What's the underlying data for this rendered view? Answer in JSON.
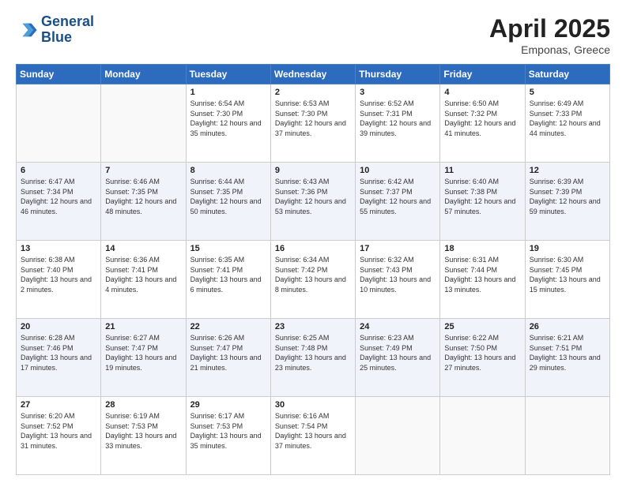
{
  "header": {
    "logo_line1": "General",
    "logo_line2": "Blue",
    "title": "April 2025",
    "location": "Emponas, Greece"
  },
  "days_of_week": [
    "Sunday",
    "Monday",
    "Tuesday",
    "Wednesday",
    "Thursday",
    "Friday",
    "Saturday"
  ],
  "weeks": [
    [
      {
        "day": "",
        "sunrise": "",
        "sunset": "",
        "daylight": ""
      },
      {
        "day": "",
        "sunrise": "",
        "sunset": "",
        "daylight": ""
      },
      {
        "day": "1",
        "sunrise": "Sunrise: 6:54 AM",
        "sunset": "Sunset: 7:30 PM",
        "daylight": "Daylight: 12 hours and 35 minutes."
      },
      {
        "day": "2",
        "sunrise": "Sunrise: 6:53 AM",
        "sunset": "Sunset: 7:30 PM",
        "daylight": "Daylight: 12 hours and 37 minutes."
      },
      {
        "day": "3",
        "sunrise": "Sunrise: 6:52 AM",
        "sunset": "Sunset: 7:31 PM",
        "daylight": "Daylight: 12 hours and 39 minutes."
      },
      {
        "day": "4",
        "sunrise": "Sunrise: 6:50 AM",
        "sunset": "Sunset: 7:32 PM",
        "daylight": "Daylight: 12 hours and 41 minutes."
      },
      {
        "day": "5",
        "sunrise": "Sunrise: 6:49 AM",
        "sunset": "Sunset: 7:33 PM",
        "daylight": "Daylight: 12 hours and 44 minutes."
      }
    ],
    [
      {
        "day": "6",
        "sunrise": "Sunrise: 6:47 AM",
        "sunset": "Sunset: 7:34 PM",
        "daylight": "Daylight: 12 hours and 46 minutes."
      },
      {
        "day": "7",
        "sunrise": "Sunrise: 6:46 AM",
        "sunset": "Sunset: 7:35 PM",
        "daylight": "Daylight: 12 hours and 48 minutes."
      },
      {
        "day": "8",
        "sunrise": "Sunrise: 6:44 AM",
        "sunset": "Sunset: 7:35 PM",
        "daylight": "Daylight: 12 hours and 50 minutes."
      },
      {
        "day": "9",
        "sunrise": "Sunrise: 6:43 AM",
        "sunset": "Sunset: 7:36 PM",
        "daylight": "Daylight: 12 hours and 53 minutes."
      },
      {
        "day": "10",
        "sunrise": "Sunrise: 6:42 AM",
        "sunset": "Sunset: 7:37 PM",
        "daylight": "Daylight: 12 hours and 55 minutes."
      },
      {
        "day": "11",
        "sunrise": "Sunrise: 6:40 AM",
        "sunset": "Sunset: 7:38 PM",
        "daylight": "Daylight: 12 hours and 57 minutes."
      },
      {
        "day": "12",
        "sunrise": "Sunrise: 6:39 AM",
        "sunset": "Sunset: 7:39 PM",
        "daylight": "Daylight: 12 hours and 59 minutes."
      }
    ],
    [
      {
        "day": "13",
        "sunrise": "Sunrise: 6:38 AM",
        "sunset": "Sunset: 7:40 PM",
        "daylight": "Daylight: 13 hours and 2 minutes."
      },
      {
        "day": "14",
        "sunrise": "Sunrise: 6:36 AM",
        "sunset": "Sunset: 7:41 PM",
        "daylight": "Daylight: 13 hours and 4 minutes."
      },
      {
        "day": "15",
        "sunrise": "Sunrise: 6:35 AM",
        "sunset": "Sunset: 7:41 PM",
        "daylight": "Daylight: 13 hours and 6 minutes."
      },
      {
        "day": "16",
        "sunrise": "Sunrise: 6:34 AM",
        "sunset": "Sunset: 7:42 PM",
        "daylight": "Daylight: 13 hours and 8 minutes."
      },
      {
        "day": "17",
        "sunrise": "Sunrise: 6:32 AM",
        "sunset": "Sunset: 7:43 PM",
        "daylight": "Daylight: 13 hours and 10 minutes."
      },
      {
        "day": "18",
        "sunrise": "Sunrise: 6:31 AM",
        "sunset": "Sunset: 7:44 PM",
        "daylight": "Daylight: 13 hours and 13 minutes."
      },
      {
        "day": "19",
        "sunrise": "Sunrise: 6:30 AM",
        "sunset": "Sunset: 7:45 PM",
        "daylight": "Daylight: 13 hours and 15 minutes."
      }
    ],
    [
      {
        "day": "20",
        "sunrise": "Sunrise: 6:28 AM",
        "sunset": "Sunset: 7:46 PM",
        "daylight": "Daylight: 13 hours and 17 minutes."
      },
      {
        "day": "21",
        "sunrise": "Sunrise: 6:27 AM",
        "sunset": "Sunset: 7:47 PM",
        "daylight": "Daylight: 13 hours and 19 minutes."
      },
      {
        "day": "22",
        "sunrise": "Sunrise: 6:26 AM",
        "sunset": "Sunset: 7:47 PM",
        "daylight": "Daylight: 13 hours and 21 minutes."
      },
      {
        "day": "23",
        "sunrise": "Sunrise: 6:25 AM",
        "sunset": "Sunset: 7:48 PM",
        "daylight": "Daylight: 13 hours and 23 minutes."
      },
      {
        "day": "24",
        "sunrise": "Sunrise: 6:23 AM",
        "sunset": "Sunset: 7:49 PM",
        "daylight": "Daylight: 13 hours and 25 minutes."
      },
      {
        "day": "25",
        "sunrise": "Sunrise: 6:22 AM",
        "sunset": "Sunset: 7:50 PM",
        "daylight": "Daylight: 13 hours and 27 minutes."
      },
      {
        "day": "26",
        "sunrise": "Sunrise: 6:21 AM",
        "sunset": "Sunset: 7:51 PM",
        "daylight": "Daylight: 13 hours and 29 minutes."
      }
    ],
    [
      {
        "day": "27",
        "sunrise": "Sunrise: 6:20 AM",
        "sunset": "Sunset: 7:52 PM",
        "daylight": "Daylight: 13 hours and 31 minutes."
      },
      {
        "day": "28",
        "sunrise": "Sunrise: 6:19 AM",
        "sunset": "Sunset: 7:53 PM",
        "daylight": "Daylight: 13 hours and 33 minutes."
      },
      {
        "day": "29",
        "sunrise": "Sunrise: 6:17 AM",
        "sunset": "Sunset: 7:53 PM",
        "daylight": "Daylight: 13 hours and 35 minutes."
      },
      {
        "day": "30",
        "sunrise": "Sunrise: 6:16 AM",
        "sunset": "Sunset: 7:54 PM",
        "daylight": "Daylight: 13 hours and 37 minutes."
      },
      {
        "day": "",
        "sunrise": "",
        "sunset": "",
        "daylight": ""
      },
      {
        "day": "",
        "sunrise": "",
        "sunset": "",
        "daylight": ""
      },
      {
        "day": "",
        "sunrise": "",
        "sunset": "",
        "daylight": ""
      }
    ]
  ]
}
